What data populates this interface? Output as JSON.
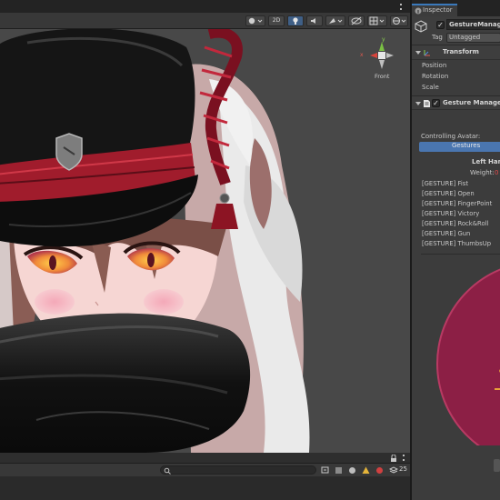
{
  "scene": {
    "toolbar": {
      "mode_2d": "2D"
    },
    "gizmo": {
      "x_label": "x",
      "y_label": "y",
      "view_label": "Front"
    },
    "status": {
      "layer_count": "25"
    }
  },
  "inspector": {
    "tab_label": "Inspector",
    "object_name": "GestureManager",
    "tag_label": "Tag",
    "tag_value": "Untagged",
    "transform": {
      "title": "Transform",
      "rows": [
        "Position",
        "Rotation",
        "Scale"
      ]
    },
    "component": {
      "title": "Gesture Manager",
      "controlling_label": "Controlling Avatar:",
      "gestures_button": "Gestures",
      "hand_title": "Left Hand",
      "weight_label": "Weight:",
      "weight_value": "0",
      "gestures": [
        "[GESTURE] Fist",
        "[GESTURE] Open",
        "[GESTURE] FingerPoint",
        "[GESTURE] Victory",
        "[GESTURE] Rock&Roll",
        "[GESTURE] Gun",
        "[GESTURE] ThumbsUp"
      ]
    }
  },
  "colors": {
    "accent_blue": "#3a79bb",
    "button_blue": "#4a76b0",
    "weight_red": "#e04b4b",
    "hat_red": "#a01c2c"
  }
}
